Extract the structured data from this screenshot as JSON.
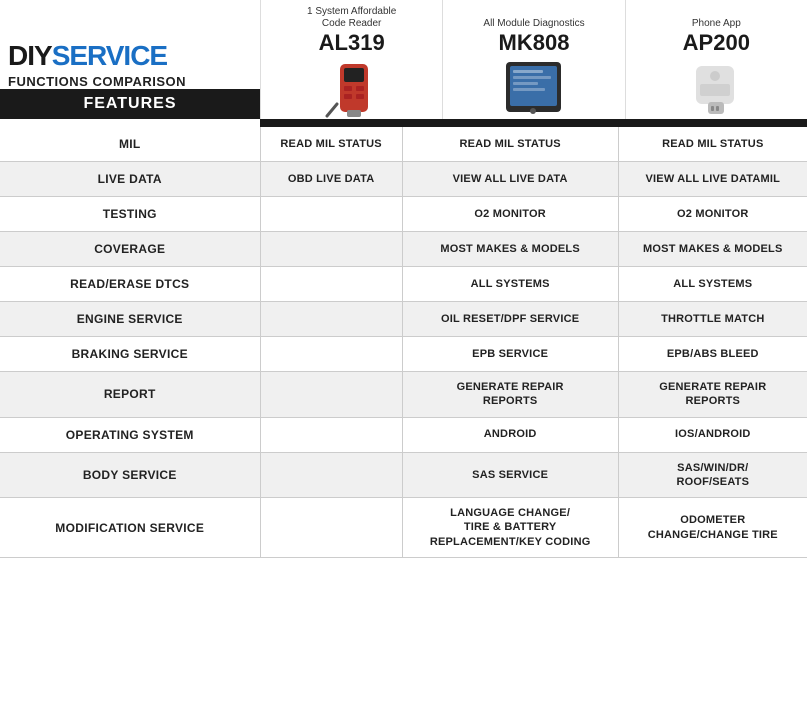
{
  "header": {
    "diy": "DIY",
    "service": "SERVICE",
    "functions_comparison": "FUNCTIONS COMPARISON",
    "features_label": "FEATURES"
  },
  "products": [
    {
      "tag": "1 System Affordable\nCode Reader",
      "name": "AL319",
      "image_type": "al319"
    },
    {
      "tag": "All Module Diagnostics",
      "name": "MK808",
      "image_type": "mk808"
    },
    {
      "tag": "Phone App",
      "name": "AP200",
      "image_type": "ap200"
    }
  ],
  "rows": [
    {
      "feature": "MIL",
      "al319": "READ MIL STATUS",
      "mk808": "READ MIL STATUS",
      "ap200": "READ MIL STATUS"
    },
    {
      "feature": "LIVE DATA",
      "al319": "OBD LIVE DATA",
      "mk808": "VIEW ALL LIVE DATA",
      "ap200": "VIEW ALL LIVE DATAMIL"
    },
    {
      "feature": "TESTING",
      "al319": "",
      "mk808": "O2 MONITOR",
      "ap200": "O2 MONITOR"
    },
    {
      "feature": "COVERAGE",
      "al319": "",
      "mk808": "MOST MAKES & MODELS",
      "ap200": "MOST MAKES & MODELS"
    },
    {
      "feature": "READ/ERASE DTCS",
      "al319": "",
      "mk808": "ALL SYSTEMS",
      "ap200": "ALL SYSTEMS"
    },
    {
      "feature": "ENGINE SERVICE",
      "al319": "",
      "mk808": "OIL RESET/DPF SERVICE",
      "ap200": "THROTTLE MATCH"
    },
    {
      "feature": "BRAKING SERVICE",
      "al319": "",
      "mk808": "EPB SERVICE",
      "ap200": "EPB/ABS BLEED"
    },
    {
      "feature": "REPORT",
      "al319": "",
      "mk808": "GENERATE REPAIR\nREPORTS",
      "ap200": "GENERATE REPAIR\nREPORTS"
    },
    {
      "feature": "OPERATING SYSTEM",
      "al319": "",
      "mk808": "ANDROID",
      "ap200": "IOS/ANDROID"
    },
    {
      "feature": "BODY SERVICE",
      "al319": "",
      "mk808": "SAS SERVICE",
      "ap200": "SAS/WIN/DR/\nROOF/SEATS"
    },
    {
      "feature": "MODIFICATION SERVICE",
      "al319": "",
      "mk808": "LANGUAGE CHANGE/\nTIRE & BATTERY\nREPLACEMENT/KEY CODING",
      "ap200": "ODOMETER\nCHANGE/CHANGE TIRE"
    }
  ]
}
